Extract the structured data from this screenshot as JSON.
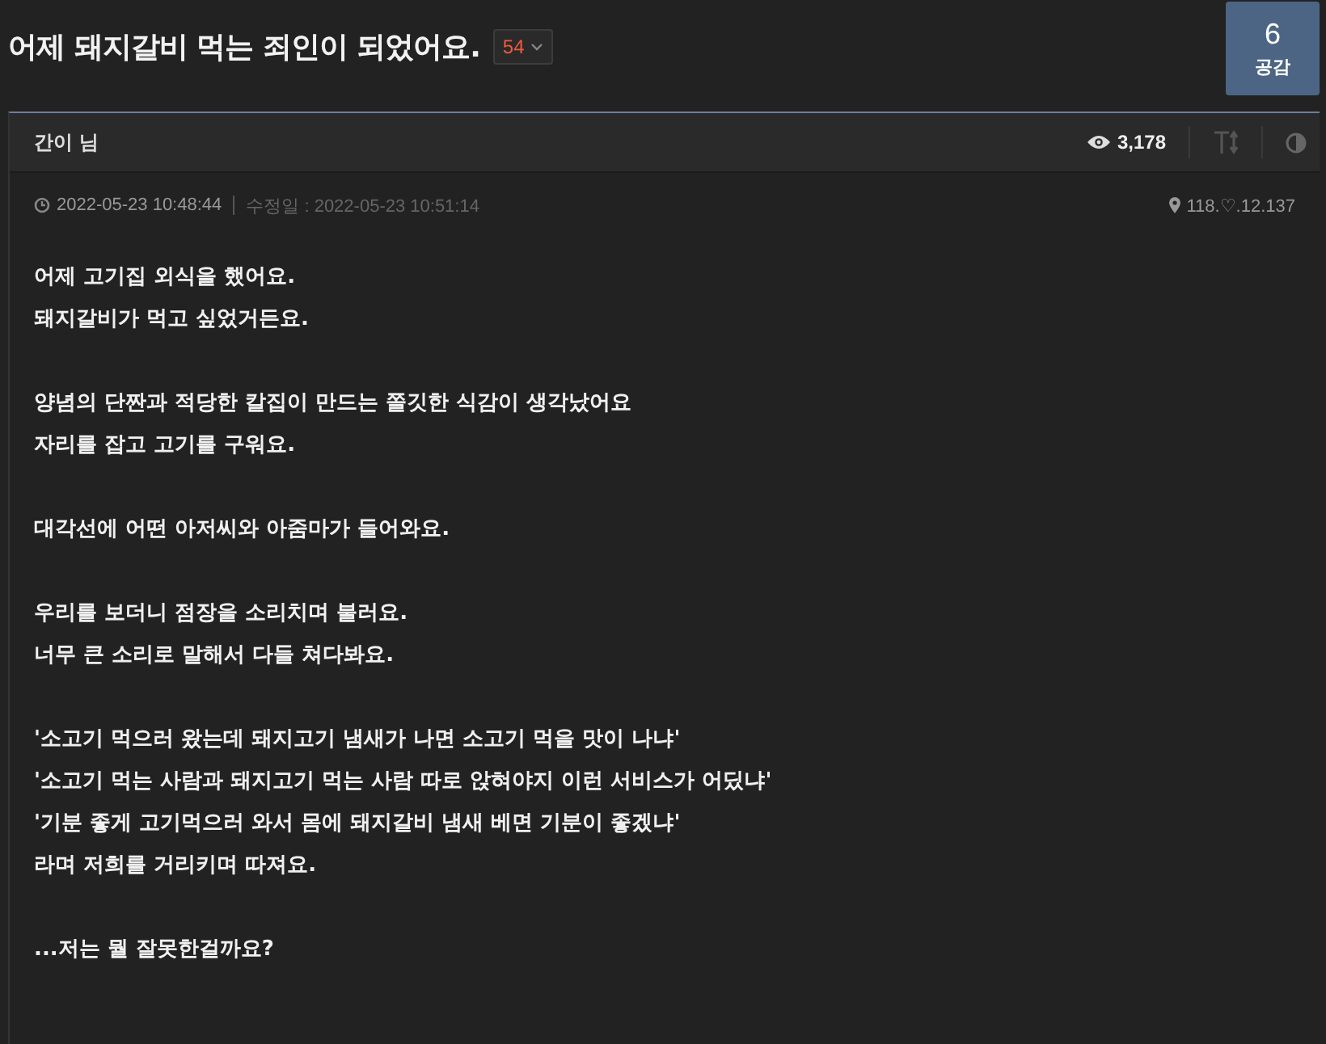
{
  "title": "어제 돼지갈비 먹는 죄인이 되었어요.",
  "comment_count": "54",
  "empathy": {
    "count": "6",
    "label": "공감"
  },
  "author": "간이 님",
  "views": "3,178",
  "posted": "2022-05-23 10:48:44",
  "edited": "수정일 : 2022-05-23 10:51:14",
  "ip": "118.♡.12.137",
  "paragraphs": [
    [
      "어제 고기집 외식을 했어요.",
      "돼지갈비가 먹고 싶었거든요."
    ],
    [
      "양념의 단짠과 적당한 칼집이 만드는 쫄깃한 식감이 생각났어요",
      "자리를 잡고 고기를 구워요."
    ],
    [
      "대각선에 어떤 아저씨와 아줌마가 들어와요."
    ],
    [
      "우리를 보더니 점장을 소리치며 불러요.",
      "너무 큰 소리로 말해서 다들 쳐다봐요."
    ],
    [
      "'소고기 먹으러 왔는데 돼지고기 냄새가 나면 소고기 먹을 맛이 나냐'",
      "'소고기 먹는 사람과 돼지고기 먹는 사람 따로 앉혀야지 이런 서비스가 어딨냐'",
      "'기분 좋게 고기먹으러 와서 몸에 돼지갈비 냄새 베면 기분이 좋겠냐'",
      "라며 저희를 거리키며 따져요."
    ],
    [
      "...저는 뭘 잘못한걸까요?"
    ]
  ]
}
